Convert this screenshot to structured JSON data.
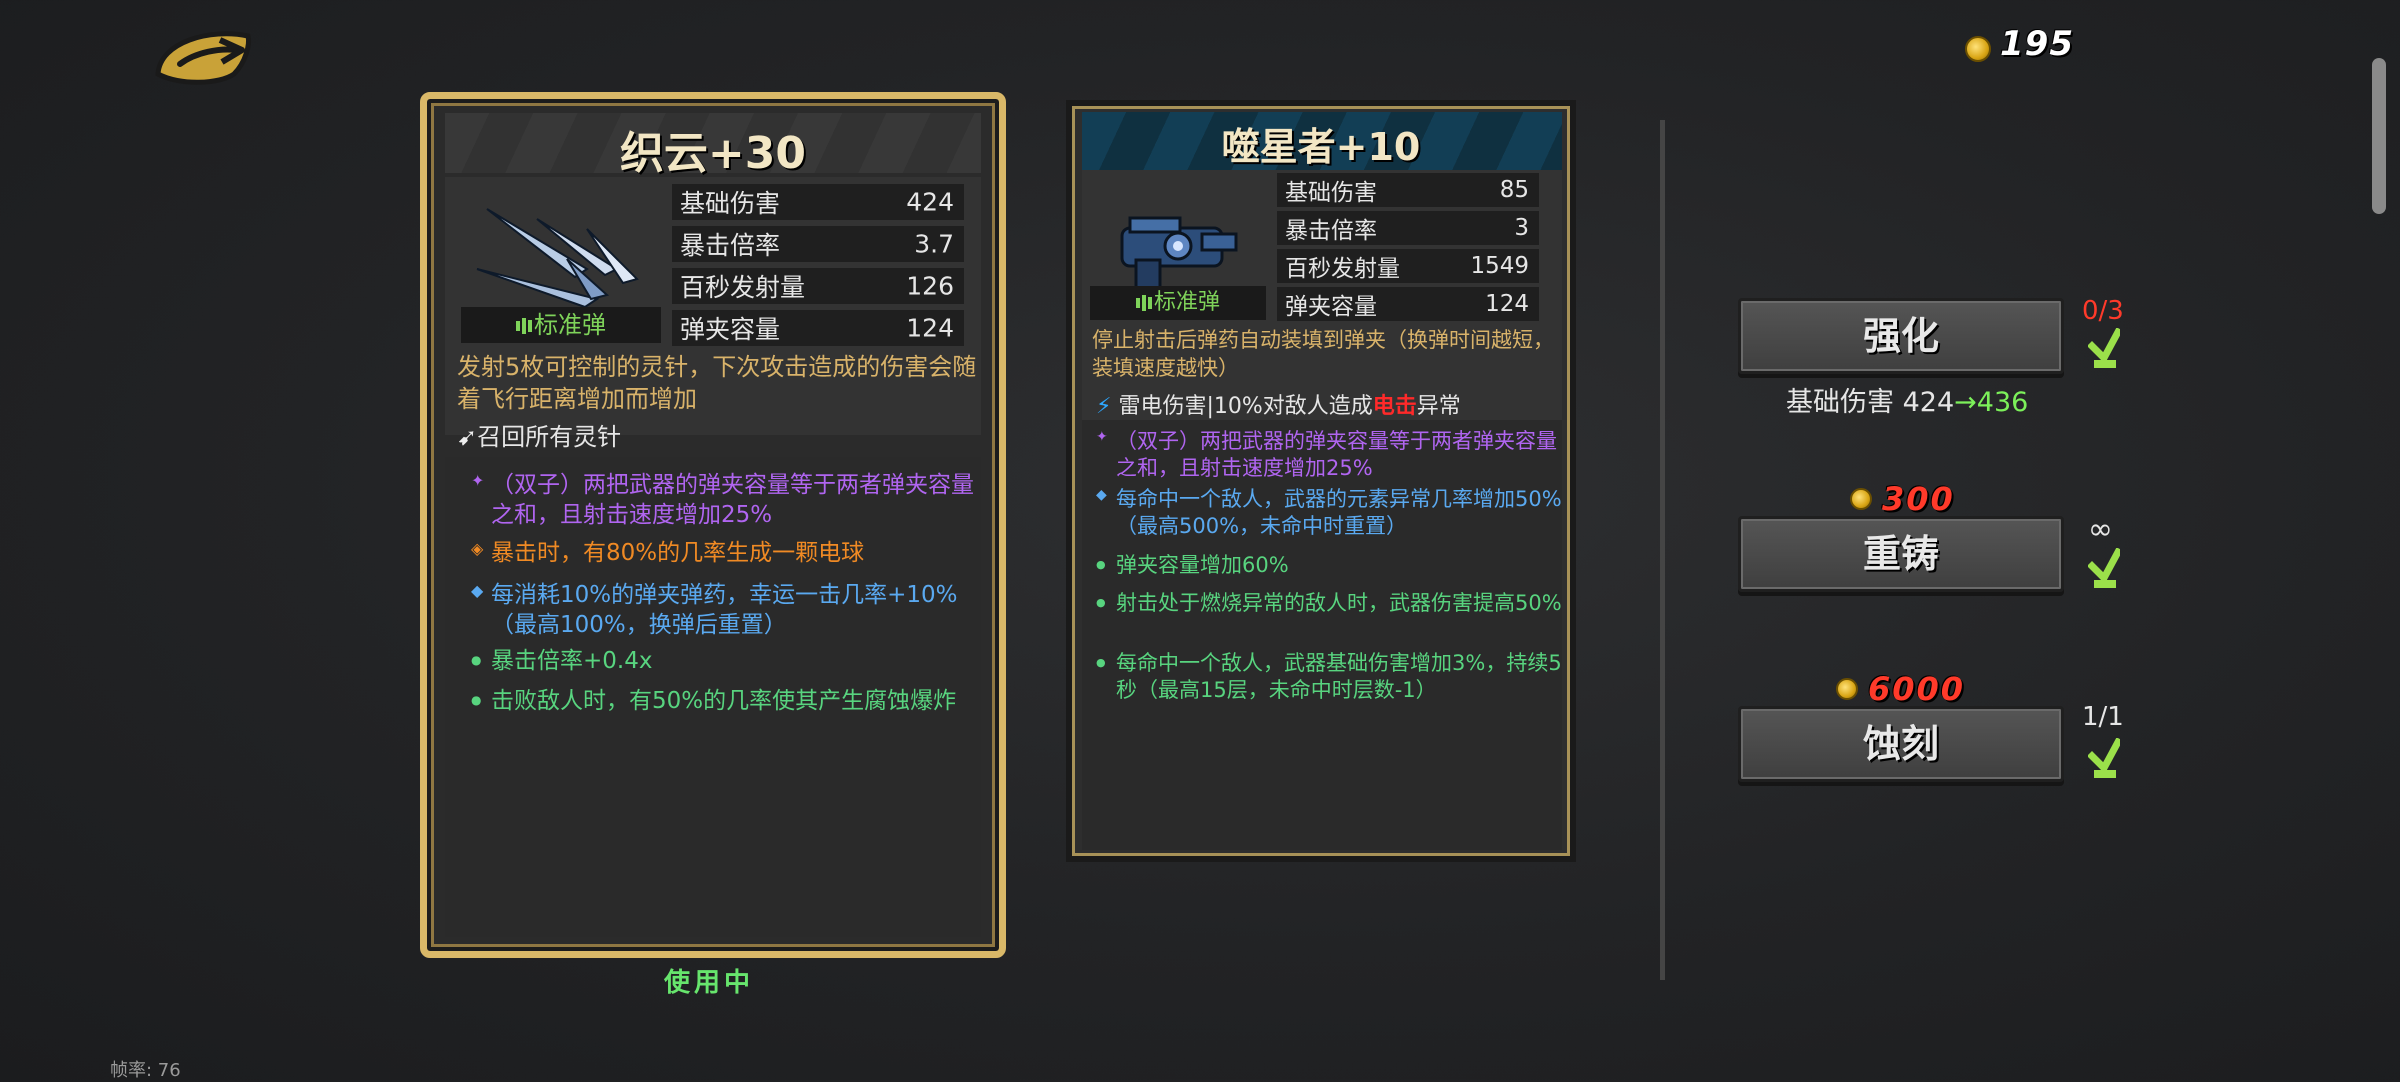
{
  "header": {
    "coins": "195"
  },
  "left_card": {
    "title": "织云+30",
    "ammo": "标准弹",
    "stats": [
      {
        "label": "基础伤害",
        "value": "424"
      },
      {
        "label": "暴击倍率",
        "value": "3.7"
      },
      {
        "label": "百秒发射量",
        "value": "126"
      },
      {
        "label": "弹夹容量",
        "value": "124"
      }
    ],
    "desc": "发射5枚可控制的灵针，下次攻击造成的伤害会随着飞行距离增加而增加",
    "trait": "召回所有灵针",
    "perks": [
      {
        "bullet": "✦",
        "color": "#b065f0",
        "text": "（双子）两把武器的弹夹容量等于两者弹夹容量之和，且射击速度增加25%"
      },
      {
        "bullet": "◈",
        "color": "#f08a24",
        "text": "暴击时，有80%的几率生成一颗电球"
      },
      {
        "bullet": "◆",
        "color": "#5aa9f0",
        "text": "每消耗10%的弹夹弹药，幸运一击几率+10%（最高100%，换弹后重置）"
      },
      {
        "bullet": "●",
        "color": "#58d47f",
        "text": "暴击倍率+0.4x"
      },
      {
        "bullet": "●",
        "color": "#58d47f",
        "text": "击败敌人时，有50%的几率使其产生腐蚀爆炸"
      }
    ],
    "status": "使用中"
  },
  "right_card": {
    "title": "噬星者+10",
    "ammo": "标准弹",
    "stats": [
      {
        "label": "基础伤害",
        "value": "85"
      },
      {
        "label": "暴击倍率",
        "value": "3"
      },
      {
        "label": "百秒发射量",
        "value": "1549"
      },
      {
        "label": "弹夹容量",
        "value": "124"
      }
    ],
    "desc": "停止射击后弹药自动装填到弹夹（换弹时间越短，装填速度越快）",
    "element_prefix": "雷电伤害|10%对敌人造成",
    "element_word": "电击",
    "element_suffix": "异常",
    "perks": [
      {
        "bullet": "✦",
        "color": "#b065f0",
        "text": "（双子）两把武器的弹夹容量等于两者弹夹容量之和，且射击速度增加25%"
      },
      {
        "bullet": "◆",
        "color": "#5aa9f0",
        "text": "每命中一个敌人，武器的元素异常几率增加50%（最高500%，未命中时重置）"
      },
      {
        "bullet": "●",
        "color": "#58d47f",
        "text": "弹夹容量增加60%"
      },
      {
        "bullet": "●",
        "color": "#58d47f",
        "text": "射击处于燃烧异常的敌人时，武器伤害提高50%"
      },
      {
        "bullet": "●",
        "color": "#58d47f",
        "text": "每命中一个敌人，武器基础伤害增加3%，持续5秒（最高15层，未命中时层数-1）"
      }
    ]
  },
  "actions": {
    "enhance": {
      "label": "强化",
      "count": "0/3",
      "preview_label": "基础伤害",
      "preview_from": "424",
      "preview_arrow": "→",
      "preview_to": "436"
    },
    "reforge": {
      "label": "重铸",
      "cost": "300",
      "count": "∞"
    },
    "etch": {
      "label": "蚀刻",
      "cost": "6000",
      "count": "1/1"
    }
  },
  "footer": {
    "fps": "帧率: 76"
  },
  "colors": {
    "gold_border": "#d9b868",
    "count_red": "#ff3a2a",
    "count_white": "#e6e6e6",
    "upgrade_green": "#7cf05a"
  }
}
